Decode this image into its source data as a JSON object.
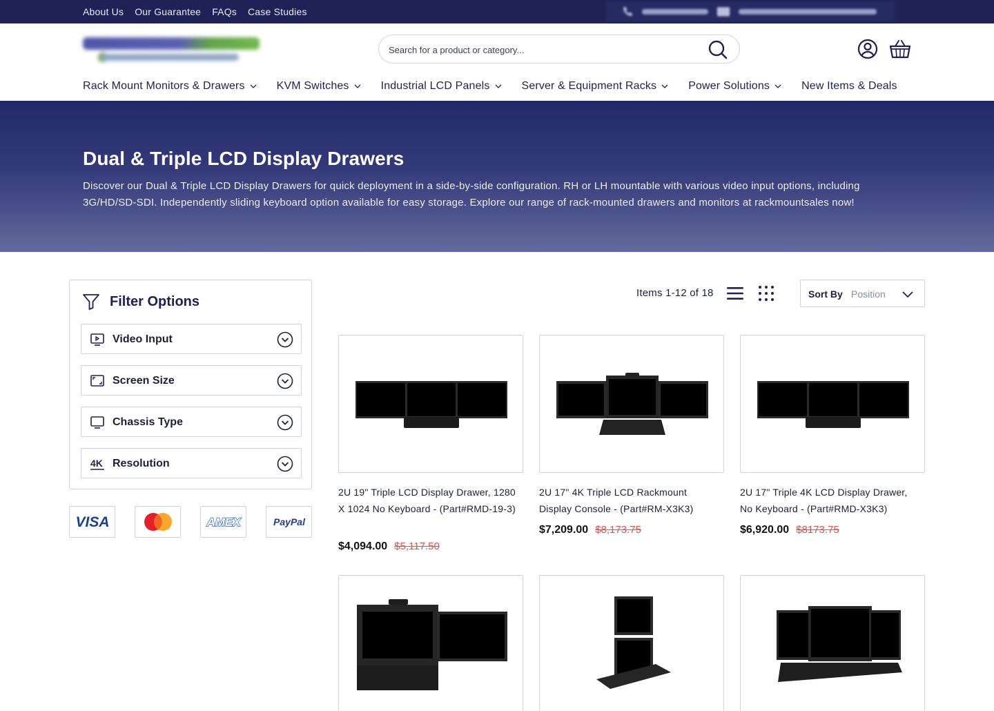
{
  "topbar": {
    "links": [
      "About Us",
      "Our Guarantee",
      "FAQs",
      "Case Studies"
    ]
  },
  "header": {
    "search_placeholder": "Search for a product or category...",
    "nav": [
      "Rack Mount Monitors & Drawers",
      "KVM Switches",
      "Industrial LCD Panels",
      "Server & Equipment Racks",
      "Power Solutions",
      "New Items & Deals"
    ]
  },
  "hero": {
    "title": "Dual & Triple LCD Display Drawers",
    "description": "Discover our Dual & Triple LCD Display Drawers for quick deployment in a side-by-side configuration. RH or LH mountable with various video input options, including 3G/HD/SD-SDI. Independently sliding keyboard option available for easy storage. Explore our range of rack-mounted drawers and monitors at rackmountsales now!"
  },
  "filters": {
    "title": "Filter Options",
    "facets": [
      "Video Input",
      "Screen Size",
      "Chassis Type",
      "Resolution"
    ],
    "resolution_icon_text": "4K"
  },
  "payments": [
    "VISA",
    "AMEX",
    "PayPal"
  ],
  "toolbar": {
    "items_count": "Items 1-12 of 18",
    "sort_label": "Sort By",
    "sort_value": "Position"
  },
  "products": [
    {
      "name": "2U 19\" Triple LCD Display Drawer, 1280 X 1024 No Keyboard - (Part#RMD-19-3)",
      "price": "$4,094.00",
      "old_price": "$5,117.50"
    },
    {
      "name": "2U 17\" 4K Triple LCD Rackmount Display Console - (Part#RM-X3K3)",
      "price": "$7,209.00",
      "old_price": "$8,173.75"
    },
    {
      "name": "2U 17\" Triple 4K LCD Display Drawer, No Keyboard - (Part#RMD-X3K3)",
      "price": "$6,920.00",
      "old_price": "$8173.75"
    },
    {
      "name": "",
      "price": "",
      "old_price": ""
    },
    {
      "name": "",
      "price": "",
      "old_price": ""
    },
    {
      "name": "",
      "price": "",
      "old_price": ""
    }
  ],
  "colors": {
    "navy": "#1e2257",
    "accent_text": "#1d2150",
    "old_price": "#d9534f",
    "border": "#cfd1db"
  }
}
